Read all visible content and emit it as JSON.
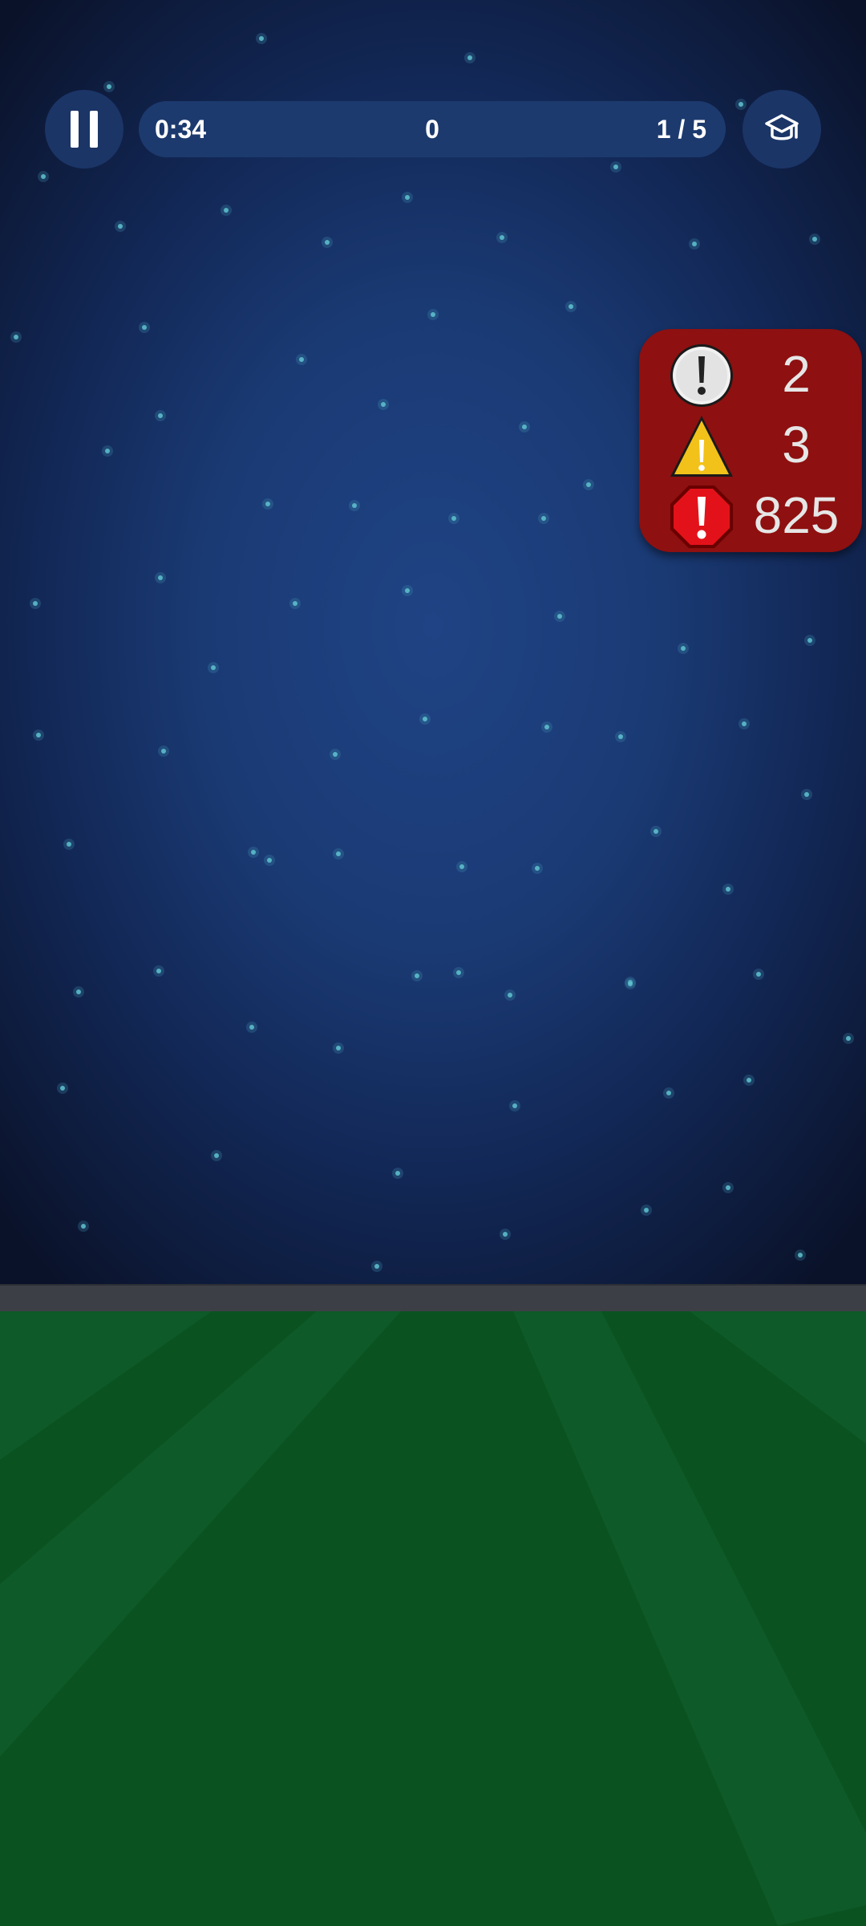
{
  "hud": {
    "timer": "0:34",
    "score": "0",
    "progress": "1 / 5"
  },
  "alerts": {
    "notice_count": "2",
    "warning_count": "3",
    "error_count": "825"
  },
  "icons": {
    "pause": "pause-icon",
    "learn": "graduation-cap-icon",
    "notice": "exclamation-circle-icon",
    "warning": "warning-triangle-icon",
    "error": "stop-sign-icon"
  },
  "colors": {
    "sky_center": "#1f4384",
    "sky_edge": "#0a1229",
    "button_bg": "#1b3567",
    "hud_bar_bg": "#1c3a6e",
    "star": "#4fb0c0",
    "track": "#3d3f47",
    "field_dark": "#0b5221",
    "field_light": "#0e5a28",
    "alert_panel": "#8e1010",
    "error_red": "#e3121a",
    "warning_yellow": "#f2c21a"
  }
}
